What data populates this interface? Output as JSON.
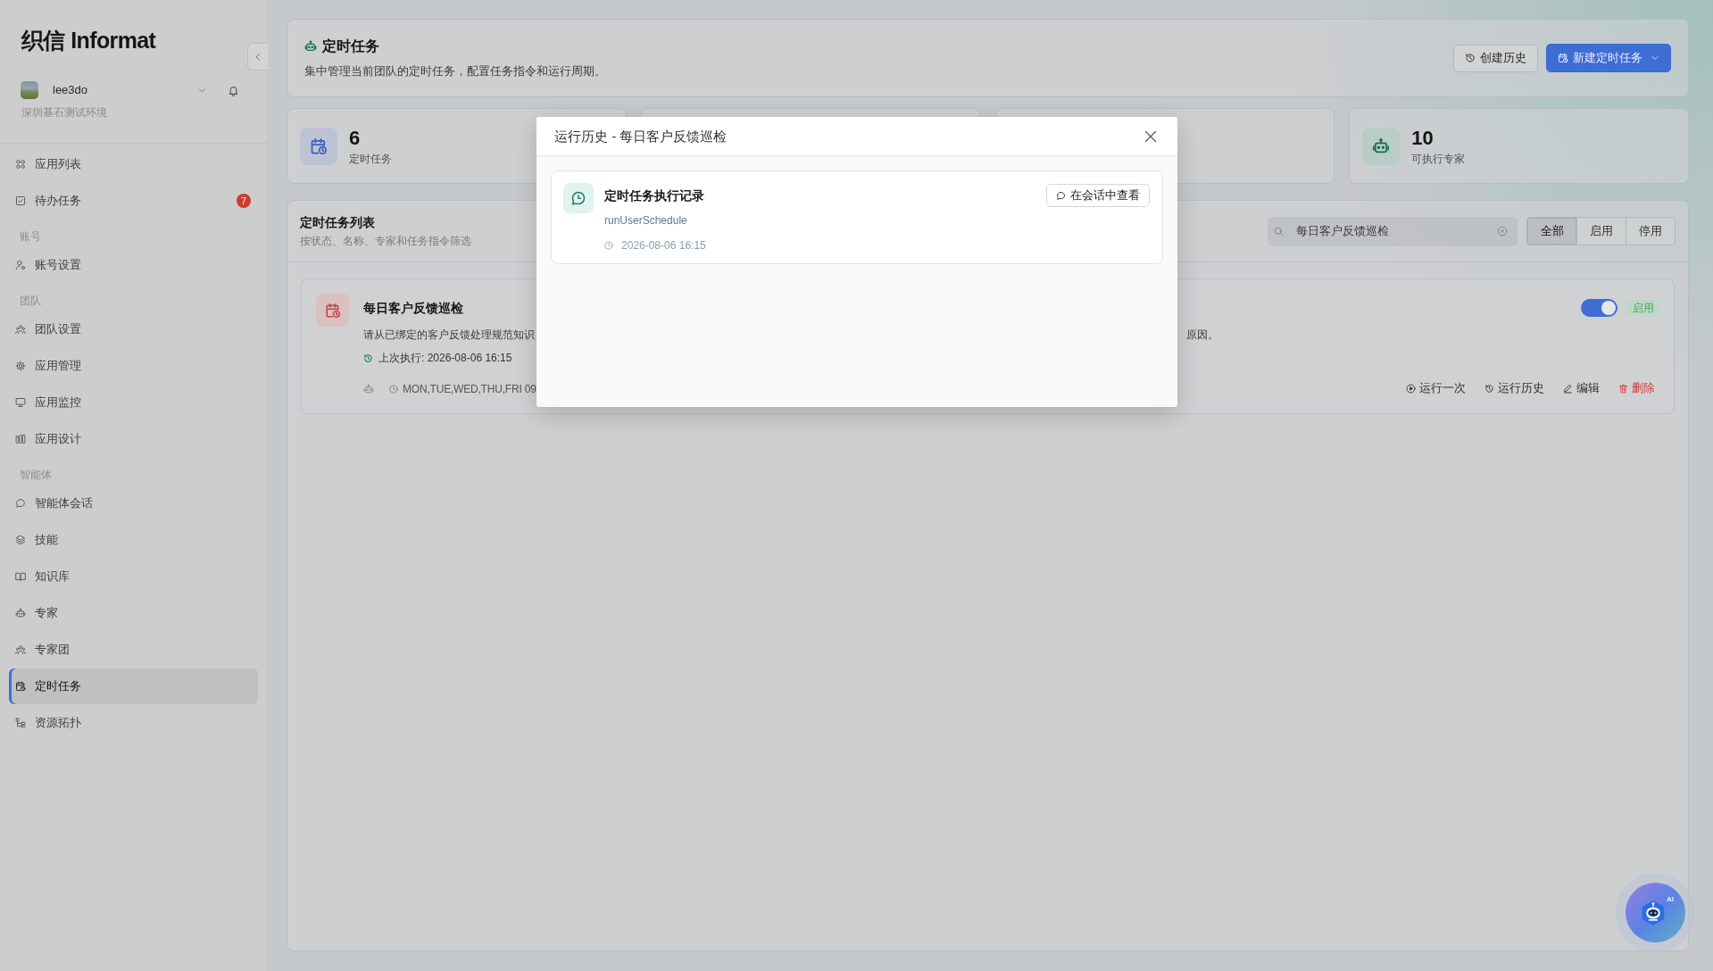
{
  "sidebar": {
    "logo": "织信 Informat",
    "user": {
      "name": "lee3do",
      "environment": "深圳基石测试环境"
    },
    "menu": [
      {
        "kind": "item",
        "label": "应用列表",
        "selected": false
      },
      {
        "kind": "item",
        "label": "待办任务",
        "selected": false,
        "badge": "7"
      },
      {
        "kind": "section",
        "label": "账号"
      },
      {
        "kind": "item",
        "label": "账号设置",
        "selected": false
      },
      {
        "kind": "section",
        "label": "团队"
      },
      {
        "kind": "item",
        "label": "团队设置",
        "selected": false
      },
      {
        "kind": "item",
        "label": "应用管理",
        "selected": false
      },
      {
        "kind": "item",
        "label": "应用监控",
        "selected": false
      },
      {
        "kind": "item",
        "label": "应用设计",
        "selected": false
      },
      {
        "kind": "section",
        "label": "智能体"
      },
      {
        "kind": "item",
        "label": "智能体会话",
        "selected": false
      },
      {
        "kind": "item",
        "label": "技能",
        "selected": false
      },
      {
        "kind": "item",
        "label": "知识库",
        "selected": false
      },
      {
        "kind": "item",
        "label": "专家",
        "selected": false
      },
      {
        "kind": "item",
        "label": "专家团",
        "selected": false
      },
      {
        "kind": "item",
        "label": "定时任务",
        "selected": true
      },
      {
        "kind": "item",
        "label": "资源拓扑",
        "selected": false
      }
    ]
  },
  "header": {
    "title": "定时任务",
    "description": "集中管理当前团队的定时任务，配置任务指令和运行周期。",
    "buttons": [
      {
        "kind": "secondary",
        "label": "创建历史"
      },
      {
        "kind": "primary",
        "label": "新建定时任务"
      }
    ]
  },
  "stats": [
    {
      "kind": "tasks",
      "value": "6",
      "label": "定时任务"
    },
    {
      "kind": "covered"
    },
    {
      "kind": "covered"
    },
    {
      "kind": "experts",
      "value": "10",
      "label": "可执行专家"
    }
  ],
  "task_list": {
    "title": "定时任务列表",
    "subtitle": "按状态、名称、专家和任务指令筛选",
    "search": {
      "value": "每日客户反馈巡检"
    },
    "filters": [
      {
        "label": "全部",
        "selected": true
      },
      {
        "label": "启用",
        "selected": false
      },
      {
        "label": "停用",
        "selected": false
      }
    ],
    "tasks": [
      {
        "name": "每日客户反馈巡检",
        "description": "请从已绑定的客户反馈处理规范知识",
        "description_tail": "原因。",
        "last_run": "上次执行: 2026-08-06 16:15",
        "schedule": "MON,TUE,WED,THU,FRI 09",
        "enabled": true,
        "status": "启用",
        "actions": [
          {
            "kind": "run",
            "label": "运行一次"
          },
          {
            "kind": "history",
            "label": "运行历史"
          },
          {
            "kind": "edit",
            "label": "编辑"
          },
          {
            "kind": "delete",
            "label": "删除"
          }
        ]
      }
    ]
  },
  "dialog": {
    "title": "运行历史 - 每日客户反馈巡检",
    "records": [
      {
        "title": "定时任务执行记录",
        "function": "runUserSchedule",
        "time": "2026-08-06 16:15",
        "button": "在会话中查看"
      }
    ]
  },
  "assistant": {
    "badge": "AI"
  }
}
